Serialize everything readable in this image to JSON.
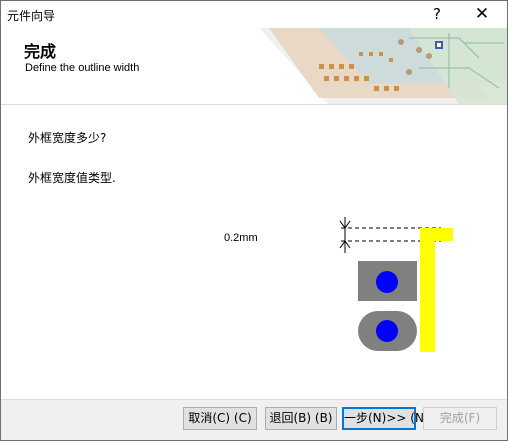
{
  "window": {
    "title": "元件向导",
    "help_label": "?",
    "close_label": "✕"
  },
  "header": {
    "title": "完成",
    "subtitle": "Define the outline width"
  },
  "content": {
    "question1": "外框宽度多少?",
    "question2": "外框宽度值类型.",
    "width_value": "0.2mm"
  },
  "buttons": {
    "cancel": "取消(C) (C)",
    "back": "退回(B) (B)",
    "next": "一步(N)>> (N",
    "finish": "完成(F)"
  },
  "colors": {
    "pad_fill": "#808080",
    "pad_hole": "#0000ff",
    "outline": "#ffff00",
    "primary_border": "#0078d7"
  },
  "icons": {
    "help": "question-mark-icon",
    "close": "close-icon",
    "banner": "pcb-banner-image"
  }
}
